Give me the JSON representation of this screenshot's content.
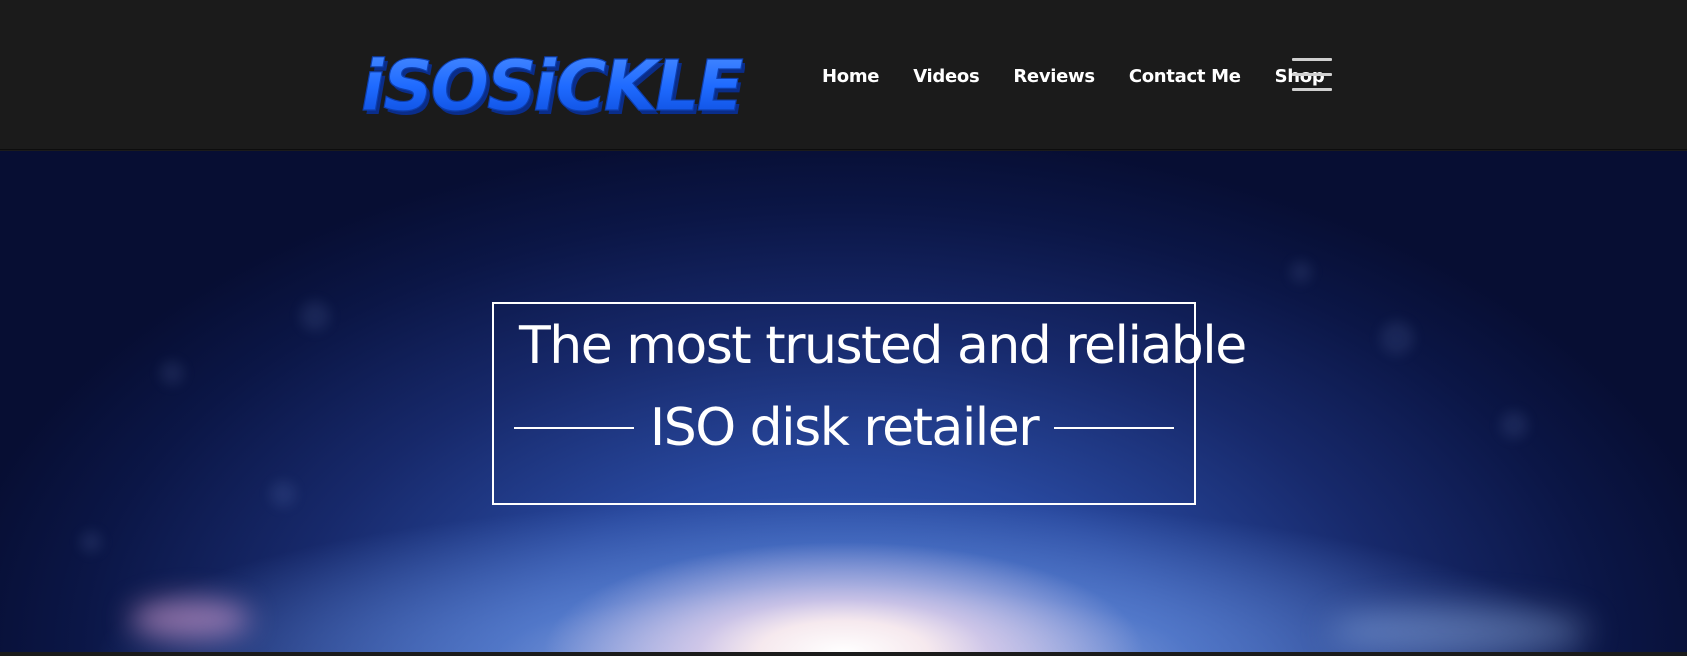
{
  "brand": {
    "logo_text": "iSOSiCKLE",
    "logo_color": "#1f6bff"
  },
  "nav": {
    "items": [
      {
        "label": "Home"
      },
      {
        "label": "Videos"
      },
      {
        "label": "Reviews"
      },
      {
        "label": "Contact Me"
      },
      {
        "label": "Shop"
      }
    ],
    "menu_icon": "hamburger-menu-icon"
  },
  "hero": {
    "line1": "The most trusted and reliable",
    "line2": "ISO disk retailer"
  },
  "colors": {
    "header_bg": "#1b1b1b",
    "hero_deep": "#070e33",
    "hero_mid": "#28489e",
    "text": "#ffffff"
  }
}
